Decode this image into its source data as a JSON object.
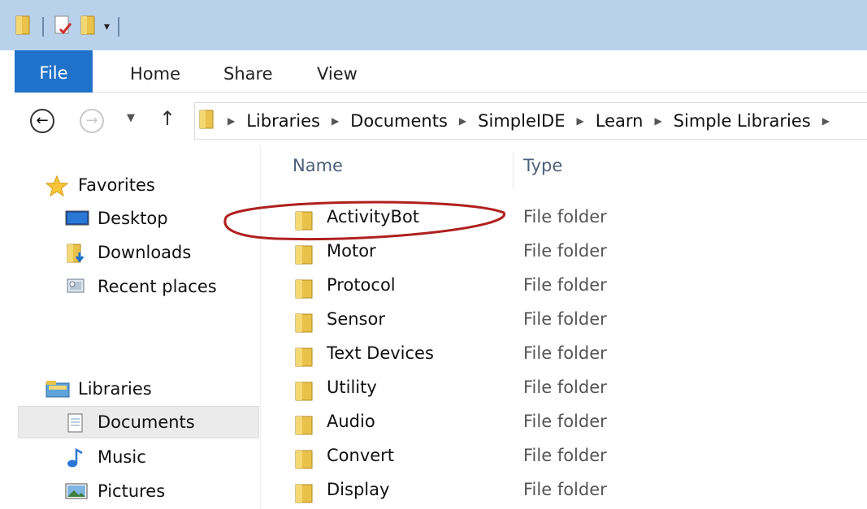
{
  "quick_access": {
    "icons": [
      "folder-icon",
      "properties-icon",
      "new-folder-icon",
      "customize-dropdown-icon"
    ]
  },
  "ribbon": {
    "tabs": [
      {
        "label": "File",
        "active": true
      },
      {
        "label": "Home"
      },
      {
        "label": "Share"
      },
      {
        "label": "View"
      }
    ],
    "accent": "#1f71c9"
  },
  "address_bar": {
    "breadcrumbs": [
      "Libraries",
      "Documents",
      "SimpleIDE",
      "Learn",
      "Simple Libraries"
    ]
  },
  "navigation_pane": {
    "favorites": {
      "label": "Favorites",
      "items": [
        {
          "label": "Desktop",
          "icon": "desktop-icon"
        },
        {
          "label": "Downloads",
          "icon": "downloads-icon"
        },
        {
          "label": "Recent places",
          "icon": "recent-places-icon"
        }
      ]
    },
    "libraries": {
      "label": "Libraries",
      "items": [
        {
          "label": "Documents",
          "icon": "documents-icon",
          "selected": true
        },
        {
          "label": "Music",
          "icon": "music-icon"
        },
        {
          "label": "Pictures",
          "icon": "pictures-icon"
        }
      ]
    }
  },
  "file_list": {
    "columns": {
      "name": "Name",
      "type": "Type"
    },
    "rows": [
      {
        "name": "ActivityBot",
        "type": "File folder",
        "circled": true
      },
      {
        "name": "Motor",
        "type": "File folder"
      },
      {
        "name": "Protocol",
        "type": "File folder"
      },
      {
        "name": "Sensor",
        "type": "File folder"
      },
      {
        "name": "Text Devices",
        "type": "File folder"
      },
      {
        "name": "Utility",
        "type": "File folder"
      },
      {
        "name": "Audio",
        "type": "File folder"
      },
      {
        "name": "Convert",
        "type": "File folder"
      },
      {
        "name": "Display",
        "type": "File folder"
      }
    ]
  },
  "colors": {
    "title_bar": "#b9d1ea",
    "annotation_circle": "#b0201e"
  }
}
